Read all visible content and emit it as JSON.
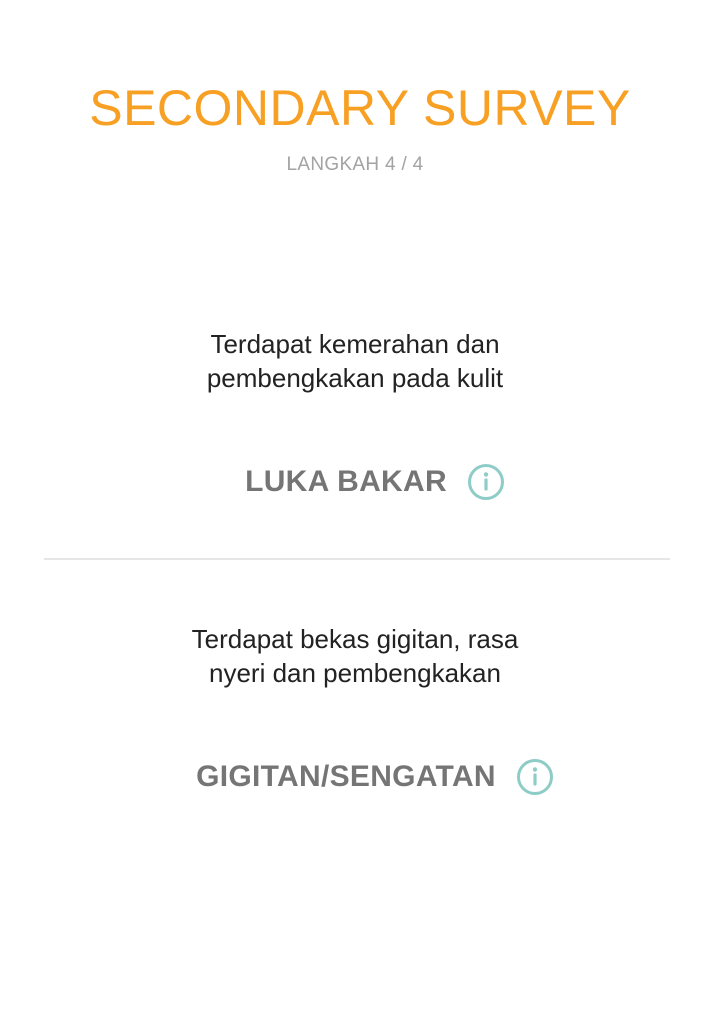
{
  "header": {
    "title": "SECONDARY SURVEY",
    "step": "LANGKAH 4 / 4"
  },
  "options": [
    {
      "description_line1": "Terdapat kemerahan dan",
      "description_line2": "pembengkakan pada kulit",
      "label": "LUKA BAKAR",
      "icon": "info-icon"
    },
    {
      "description_line1": "Terdapat bekas gigitan, rasa",
      "description_line2": "nyeri dan pembengkakan",
      "label": "GIGITAN/SENGATAN",
      "icon": "info-icon"
    }
  ],
  "colors": {
    "title": "#f7a024",
    "step": "#a3a3a3",
    "label": "#757575",
    "info_icon": "#8ecdc7",
    "divider": "#e6e6e6"
  }
}
